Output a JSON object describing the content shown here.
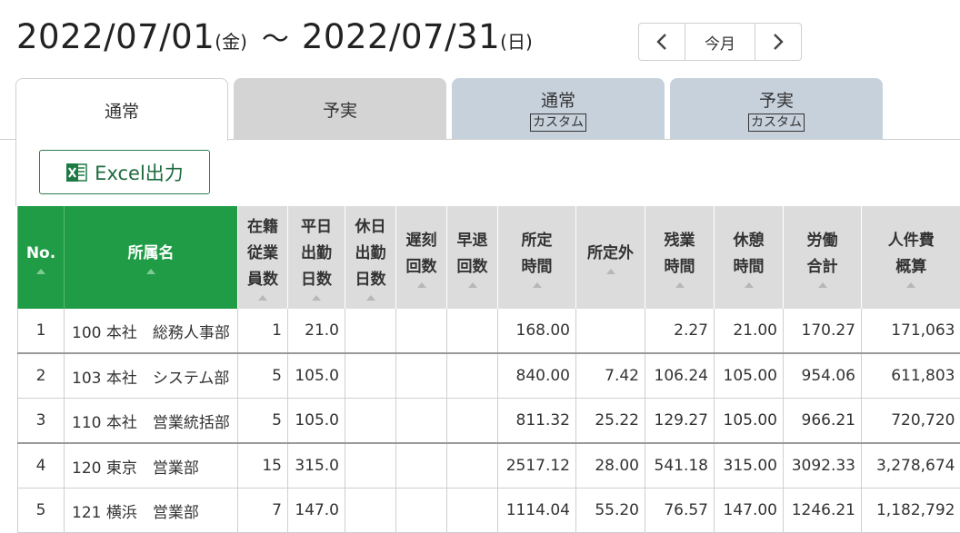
{
  "header": {
    "start_date": "2022/07/01",
    "start_dow": "(金)",
    "separator": "～",
    "end_date": "2022/07/31",
    "end_dow": "(日)"
  },
  "pager": {
    "today_label": "今月"
  },
  "tabs": [
    {
      "label": "通常",
      "sub": ""
    },
    {
      "label": "予実",
      "sub": ""
    },
    {
      "label": "通常",
      "sub": "カスタム"
    },
    {
      "label": "予実",
      "sub": "カスタム"
    }
  ],
  "excel_button": {
    "label": "Excel出力"
  },
  "colors": {
    "header_green": "#1f9c45",
    "excel_green": "#1e6b3f"
  },
  "table": {
    "columns": [
      {
        "lines": [
          "No."
        ]
      },
      {
        "lines": [
          "所属名"
        ]
      },
      {
        "lines": [
          "在籍",
          "従業",
          "員数"
        ]
      },
      {
        "lines": [
          "平日",
          "出勤",
          "日数"
        ]
      },
      {
        "lines": [
          "休日",
          "出勤",
          "日数"
        ]
      },
      {
        "lines": [
          "遅刻",
          "回数"
        ]
      },
      {
        "lines": [
          "早退",
          "回数"
        ]
      },
      {
        "lines": [
          "所定",
          "時間"
        ]
      },
      {
        "lines": [
          "所定外"
        ]
      },
      {
        "lines": [
          "残業",
          "時間"
        ]
      },
      {
        "lines": [
          "休憩",
          "時間"
        ]
      },
      {
        "lines": [
          "労働",
          "合計"
        ]
      },
      {
        "lines": [
          "人件費",
          "概算"
        ]
      }
    ],
    "rows": [
      [
        "1",
        "100 本社　総務人事部",
        "1",
        "21.0",
        "",
        "",
        "",
        "168.00",
        "",
        "2.27",
        "21.00",
        "170.27",
        "171,063"
      ],
      [
        "2",
        "103 本社　システム部",
        "5",
        "105.0",
        "",
        "",
        "",
        "840.00",
        "7.42",
        "106.24",
        "105.00",
        "954.06",
        "611,803"
      ],
      [
        "3",
        "110 本社　営業統括部",
        "5",
        "105.0",
        "",
        "",
        "",
        "811.32",
        "25.22",
        "129.27",
        "105.00",
        "966.21",
        "720,720"
      ],
      [
        "4",
        "120 東京　営業部",
        "15",
        "315.0",
        "",
        "",
        "",
        "2517.12",
        "28.00",
        "541.18",
        "315.00",
        "3092.33",
        "3,278,674"
      ],
      [
        "5",
        "121 横浜　営業部",
        "7",
        "147.0",
        "",
        "",
        "",
        "1114.04",
        "55.20",
        "76.57",
        "147.00",
        "1246.21",
        "1,182,792"
      ]
    ]
  }
}
